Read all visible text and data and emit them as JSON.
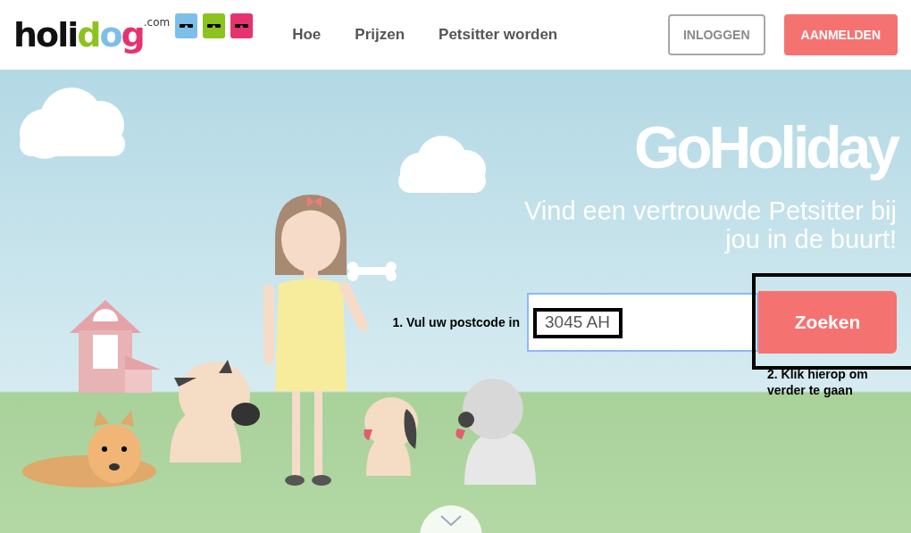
{
  "logo": {
    "parts": [
      {
        "text": "holi",
        "color": "#111111"
      },
      {
        "text": "d",
        "color": "#8dc21f"
      },
      {
        "text": "o",
        "color": "#7cbfe8"
      },
      {
        "text": "g",
        "color": "#e6336f"
      }
    ],
    "suffix": ".com"
  },
  "nav": [
    {
      "label": "Hoe"
    },
    {
      "label": "Prijzen"
    },
    {
      "label": "Petsitter worden"
    }
  ],
  "actions": [
    {
      "label": "INLOGGEN",
      "kind": "outline"
    },
    {
      "label": "AANMELDEN",
      "kind": "filled"
    }
  ],
  "hero": {
    "title": "GoHoliday",
    "subtitle": "Vind een vertrouwde Petsitter bij jou in de buurt!",
    "search": {
      "value": "3045 AH",
      "button": "Zoeken"
    }
  },
  "annotations": [
    {
      "text": "1. Vul uw postcode in"
    },
    {
      "text": "2. Klik hierop om verder te gaan"
    }
  ]
}
